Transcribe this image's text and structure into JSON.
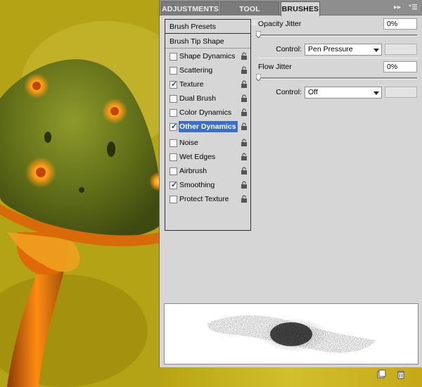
{
  "tabs": [
    {
      "label": "ADJUSTMENTS",
      "active": false
    },
    {
      "label": "TOOL PRESETS",
      "active": false
    },
    {
      "label": "BRUSHES",
      "active": true
    }
  ],
  "tab_controls": {
    "collapse_icon": "double-arrow-icon",
    "menu_icon": "panel-menu-icon"
  },
  "brush_list": {
    "presets_label": "Brush Presets",
    "tip_shape_label": "Brush Tip Shape",
    "items": [
      {
        "label": "Shape Dynamics",
        "checked": false,
        "selected": false
      },
      {
        "label": "Scattering",
        "checked": false,
        "selected": false
      },
      {
        "label": "Texture",
        "checked": true,
        "selected": false
      },
      {
        "label": "Dual Brush",
        "checked": false,
        "selected": false
      },
      {
        "label": "Color Dynamics",
        "checked": false,
        "selected": false
      },
      {
        "label": "Other Dynamics",
        "checked": true,
        "selected": true
      },
      {
        "label": "Noise",
        "checked": false,
        "selected": false
      },
      {
        "label": "Wet Edges",
        "checked": false,
        "selected": false
      },
      {
        "label": "Airbrush",
        "checked": false,
        "selected": false
      },
      {
        "label": "Smoothing",
        "checked": true,
        "selected": false
      },
      {
        "label": "Protect Texture",
        "checked": false,
        "selected": false
      }
    ]
  },
  "opacity_jitter": {
    "label": "Opacity Jitter",
    "value": "0%",
    "control_label": "Control:",
    "control_value": "Pen Pressure"
  },
  "flow_jitter": {
    "label": "Flow Jitter",
    "value": "0%",
    "control_label": "Control:",
    "control_value": "Off"
  },
  "bottom_icons": [
    "new-brush-icon",
    "trash-icon"
  ],
  "colors": {
    "panel_bg": "#d6d6d6",
    "tab_bg": "#8e8e8e",
    "selection": "#3c6ec8",
    "artwork_glow": "#ff8a00"
  }
}
